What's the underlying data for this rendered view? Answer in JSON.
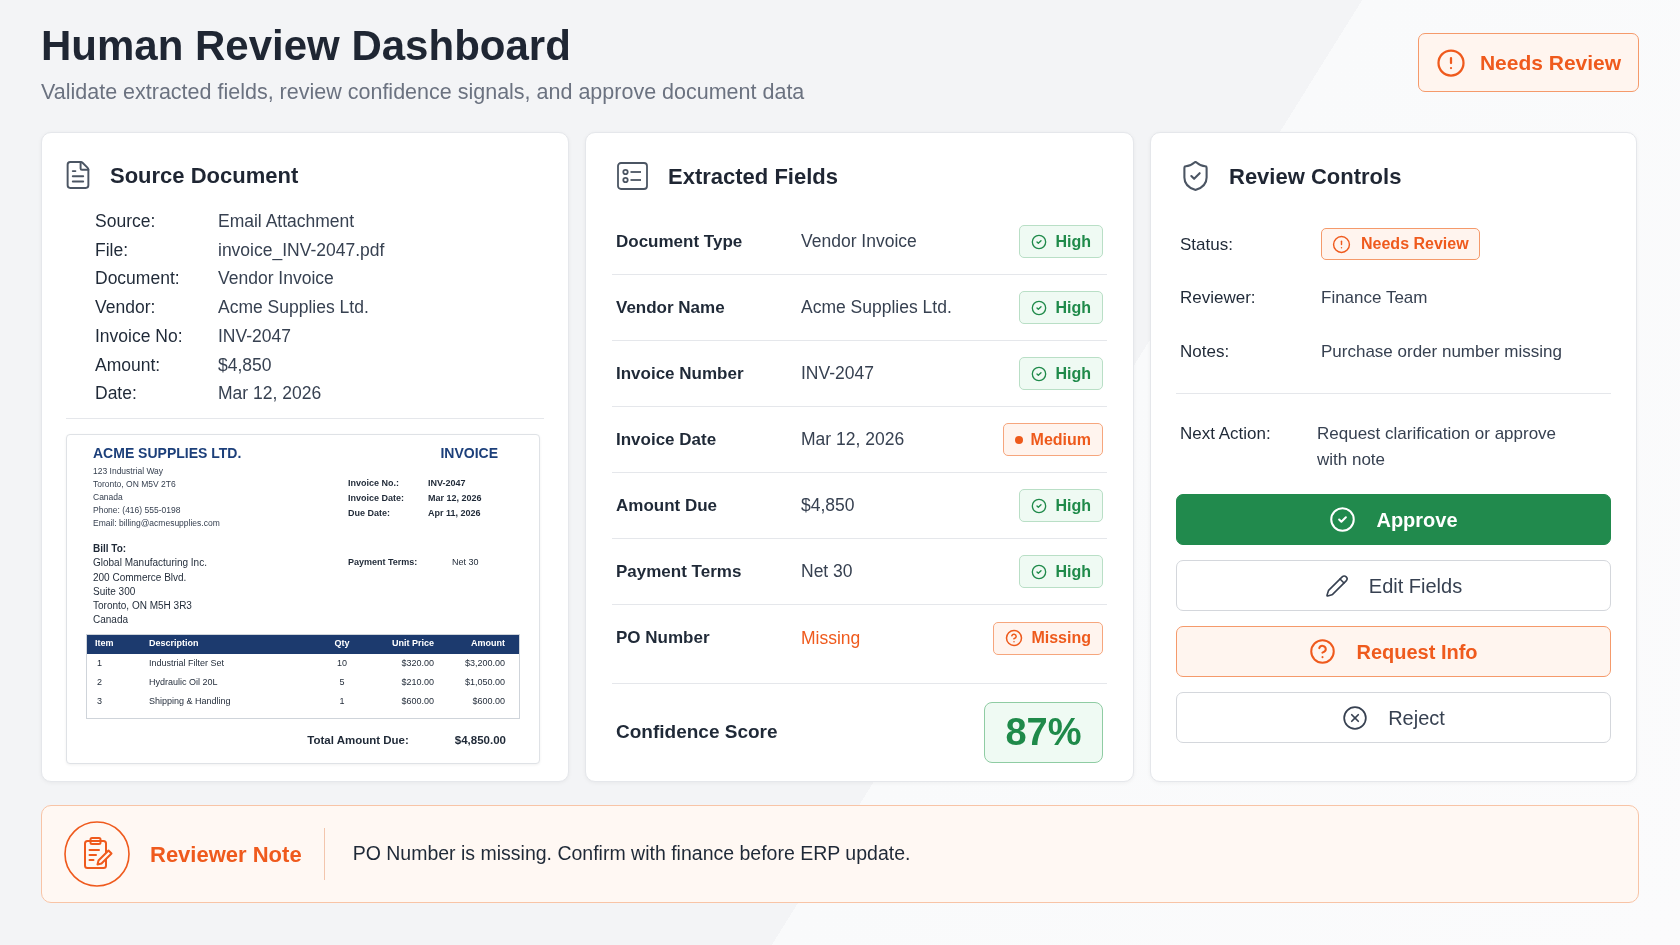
{
  "header": {
    "title": "Human Review Dashboard",
    "subtitle": "Validate extracted fields, review confidence signals, and approve document data",
    "status": {
      "label": "Needs Review"
    }
  },
  "source_document": {
    "title": "Source Document",
    "fields": [
      {
        "label": "Source:",
        "value": "Email Attachment"
      },
      {
        "label": "File:",
        "value": "invoice_INV-2047.pdf"
      },
      {
        "label": "Document:",
        "value": "Vendor Invoice"
      },
      {
        "label": "Vendor:",
        "value": "Acme Supplies Ltd."
      },
      {
        "label": "Invoice No:",
        "value": "INV-2047"
      },
      {
        "label": "Amount:",
        "value": "$4,850"
      },
      {
        "label": "Date:",
        "value": "Mar 12, 2026"
      }
    ],
    "invoice_preview": {
      "company": "ACME SUPPLIES LTD.",
      "heading": "INVOICE",
      "address_lines": [
        "123 Industrial Way",
        "Toronto, ON M5V 2T6",
        "Canada",
        "Phone: (416) 555-0198",
        "Email: billing@acmesupplies.com"
      ],
      "meta": [
        {
          "label": "Invoice No.:",
          "value": "INV-2047"
        },
        {
          "label": "Invoice Date:",
          "value": "Mar 12, 2026"
        },
        {
          "label": "Due Date:",
          "value": "Apr 11, 2026"
        }
      ],
      "bill_to": {
        "label": "Bill To:",
        "lines": [
          "Global Manufacturing Inc.",
          "200 Commerce Blvd.",
          "Suite 300",
          "Toronto, ON M5H 3R3",
          "Canada"
        ]
      },
      "payment_terms": {
        "label": "Payment Terms:",
        "value": "Net 30"
      },
      "table": {
        "columns": [
          "Item",
          "Description",
          "Qty",
          "Unit Price",
          "Amount"
        ],
        "rows": [
          [
            "1",
            "Industrial Filter Set",
            "10",
            "$320.00",
            "$3,200.00"
          ],
          [
            "2",
            "Hydraulic Oil 20L",
            "5",
            "$210.00",
            "$1,050.00"
          ],
          [
            "3",
            "Shipping & Handling",
            "1",
            "$600.00",
            "$600.00"
          ]
        ]
      },
      "total": {
        "label": "Total Amount Due:",
        "value": "$4,850.00"
      }
    }
  },
  "extracted_fields": {
    "title": "Extracted Fields",
    "rows": [
      {
        "label": "Document Type",
        "value": "Vendor Invoice",
        "confidence": "High",
        "kind": "high"
      },
      {
        "label": "Vendor Name",
        "value": "Acme Supplies Ltd.",
        "confidence": "High",
        "kind": "high"
      },
      {
        "label": "Invoice Number",
        "value": "INV-2047",
        "confidence": "High",
        "kind": "high"
      },
      {
        "label": "Invoice Date",
        "value": "Mar 12, 2026",
        "confidence": "Medium",
        "kind": "medium"
      },
      {
        "label": "Amount Due",
        "value": "$4,850",
        "confidence": "High",
        "kind": "high"
      },
      {
        "label": "Payment Terms",
        "value": "Net 30",
        "confidence": "High",
        "kind": "high"
      },
      {
        "label": "PO Number",
        "value": "Missing",
        "confidence": "Missing",
        "kind": "missing"
      }
    ],
    "confidence_score": {
      "label": "Confidence Score",
      "value": "87%"
    }
  },
  "review_controls": {
    "title": "Review Controls",
    "fields": [
      {
        "label": "Status:",
        "value": "Needs Review",
        "kind": "badge"
      },
      {
        "label": "Reviewer:",
        "value": "Finance Team",
        "kind": "text"
      },
      {
        "label": "Notes:",
        "value": "Purchase order number missing",
        "kind": "text"
      }
    ],
    "next_action": {
      "label": "Next Action:",
      "value": "Request clarification or approve with note"
    },
    "buttons": [
      {
        "label": "Approve",
        "kind": "approve"
      },
      {
        "label": "Edit Fields",
        "kind": "edit"
      },
      {
        "label": "Request Info",
        "kind": "request"
      },
      {
        "label": "Reject",
        "kind": "reject"
      }
    ]
  },
  "reviewer_note": {
    "title": "Reviewer Note",
    "text": "PO Number is missing. Confirm with finance before ERP update."
  }
}
